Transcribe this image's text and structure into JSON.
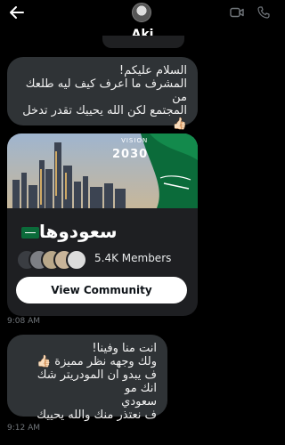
{
  "header": {
    "name": "Aki",
    "back_icon": "arrow-left-icon",
    "video_icon": "video-camera-icon",
    "phone_icon": "phone-icon"
  },
  "messages": [
    {
      "lines": [
        "السلام عليكم!",
        "المشرف ما اعرف كيف ليه طلعك من",
        "المجتمع لكن الله يحييك تقدر تدخل"
      ],
      "emoji": "👍🏻"
    },
    {
      "lines": [
        "انت منا وفينا!",
        "ولك وجهه نظر مميزة 👍🏻",
        "ف يبدو ان المودريتر شك انك مو",
        "سعودي",
        "ف نعتذر منك والله يحييك"
      ]
    }
  ],
  "community_card": {
    "banner_text_top": "VISION",
    "banner_text_main": "2030",
    "name": "سعودوها",
    "members": "5.4K Members",
    "button_label": "View Community",
    "colors": {
      "flag_green": "#0b6b3a",
      "sky": "#2a5b86"
    }
  },
  "timestamps": [
    "9:08 AM",
    "9:12 AM"
  ]
}
